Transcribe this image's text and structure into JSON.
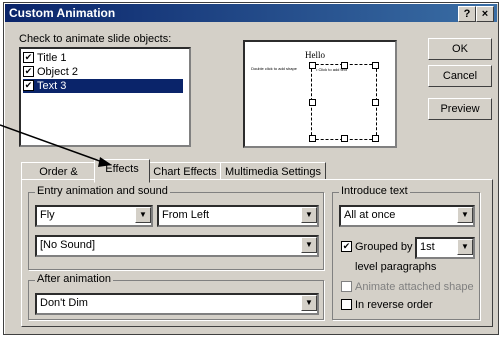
{
  "window": {
    "title": "Custom Animation",
    "help_label": "?",
    "close_label": "×"
  },
  "objects": {
    "header": "Check to animate slide objects:",
    "items": [
      {
        "label": "Title 1",
        "checked": true
      },
      {
        "label": "Object 2",
        "checked": true
      },
      {
        "label": "Text 3",
        "checked": true,
        "selected": true
      }
    ]
  },
  "preview_thumb": {
    "title": "Hello",
    "left_text": "Double click to add shape",
    "bullet_text": "• Click to add text"
  },
  "buttons": {
    "ok": "OK",
    "cancel": "Cancel",
    "preview": "Preview"
  },
  "tabs": [
    "Order & Timing",
    "Effects",
    "Chart Effects",
    "Multimedia Settings"
  ],
  "active_tab": "Effects",
  "entry": {
    "group_label": "Entry animation and sound",
    "effect": "Fly",
    "direction": "From Left",
    "sound": "[No Sound]"
  },
  "after": {
    "group_label": "After animation",
    "value": "Don't Dim"
  },
  "introduce": {
    "group_label": "Introduce text",
    "mode": "All at once",
    "grouped_label": "Grouped by",
    "grouped_checked": true,
    "grouped_level": "1st",
    "level_paragraphs": "level paragraphs",
    "animate_attached": "Animate attached shape",
    "reverse_order": "In reverse order"
  },
  "icons": {
    "check": "✔",
    "arrow": "▼"
  }
}
